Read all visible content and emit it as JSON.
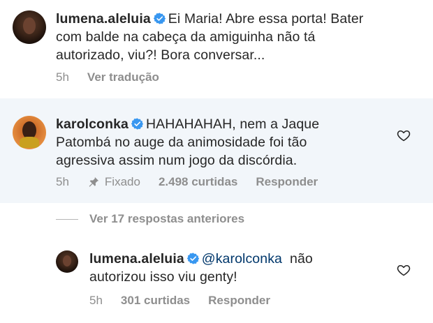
{
  "comment1": {
    "username": "lumena.aleluia",
    "line1": "Ei Maria! Abre essa porta! Bater",
    "line2": "com balde na cabeça da amiguinha não tá",
    "line3": "autorizado, viu?! Bora conversar...",
    "time": "5h",
    "translate": "Ver tradução"
  },
  "comment2": {
    "username": "karolconka",
    "line1": "HAHAHAHAH, nem a Jaque",
    "line2": "Patombá no auge da animosidade foi tão",
    "line3": "agressiva assim num jogo da discórdia.",
    "time": "5h",
    "pinned": "Fixado",
    "likes": "2.498 curtidas",
    "reply": "Responder"
  },
  "view_previous": "Ver 17 respostas anteriores",
  "reply1": {
    "username": "lumena.aleluia",
    "mention": "@karolconka",
    "line1_rest": "não",
    "line2": "autorizou isso viu genty!",
    "time": "5h",
    "likes": "301 curtidas",
    "reply": "Responder"
  },
  "colors": {
    "verified": "#3897f0",
    "meta_text": "#8e8e8e",
    "pinned_bg": "#f2f6fa",
    "mention": "#00376b"
  },
  "icons": [
    "verified-badge-icon",
    "pin-icon",
    "heart-icon"
  ]
}
